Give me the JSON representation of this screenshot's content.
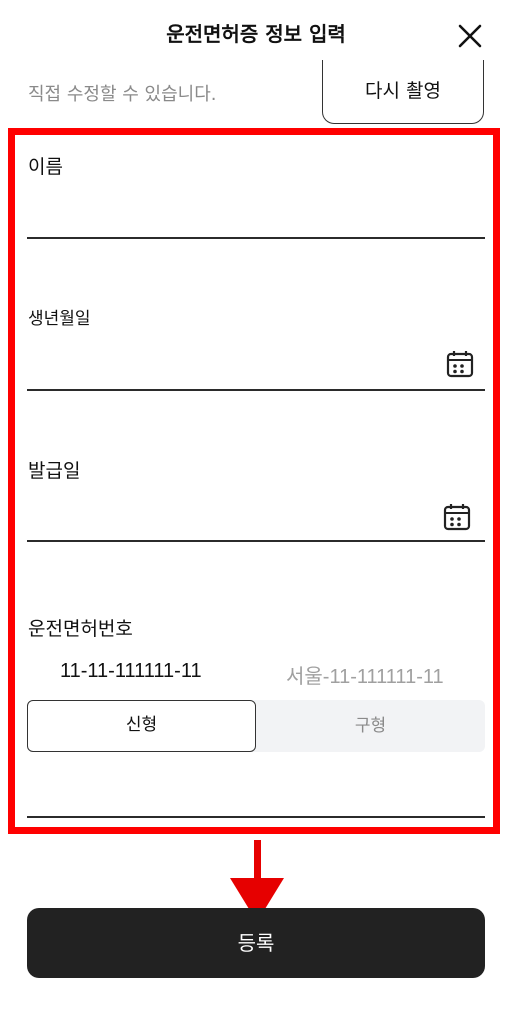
{
  "header": {
    "title": "운전면허증 정보 입력"
  },
  "hint_text": "직접 수정할 수 있습니다.",
  "retake_label": "다시 촬영",
  "fields": {
    "name": {
      "label": "이름",
      "value": ""
    },
    "birth": {
      "label": "생년월일",
      "value": ""
    },
    "issue": {
      "label": "발급일",
      "value": ""
    },
    "license": {
      "label": "운전면허번호",
      "format_new": "11-11-111111-11",
      "format_old": "서울-11-111111-11",
      "value": ""
    }
  },
  "segment": {
    "new_label": "신형",
    "old_label": "구형",
    "selected": "신형"
  },
  "submit_label": "등록",
  "icons": {
    "close": "close-icon",
    "calendar": "calendar-icon"
  },
  "colors": {
    "highlight": "#ff0000",
    "arrow": "#e60000",
    "submit_bg": "#222222"
  }
}
